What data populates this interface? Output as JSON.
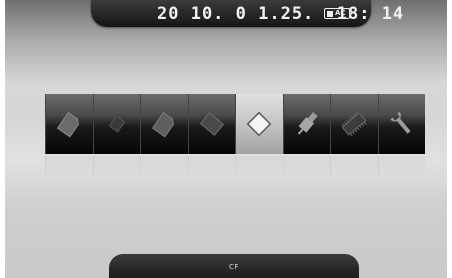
{
  "status_bar": {
    "datetime": "20 10. 0 1.25.  18: 14",
    "power_label": "AC"
  },
  "media_strip": {
    "items": [
      {
        "icon": "sd-card-icon"
      },
      {
        "icon": "memory-card-icon"
      },
      {
        "icon": "sd-card-alt-icon"
      },
      {
        "icon": "memory-stick-icon"
      },
      {
        "icon": "cf-card-icon",
        "selected": true
      },
      {
        "icon": "usb-icon"
      },
      {
        "icon": "internal-memory-icon"
      },
      {
        "icon": "wrench-icon"
      }
    ]
  },
  "footer": {
    "selected_label": "CF"
  },
  "colors": {
    "bar": "#1b1b1b",
    "selected": "#cfcfcf",
    "icon": "#9a9a9a"
  }
}
